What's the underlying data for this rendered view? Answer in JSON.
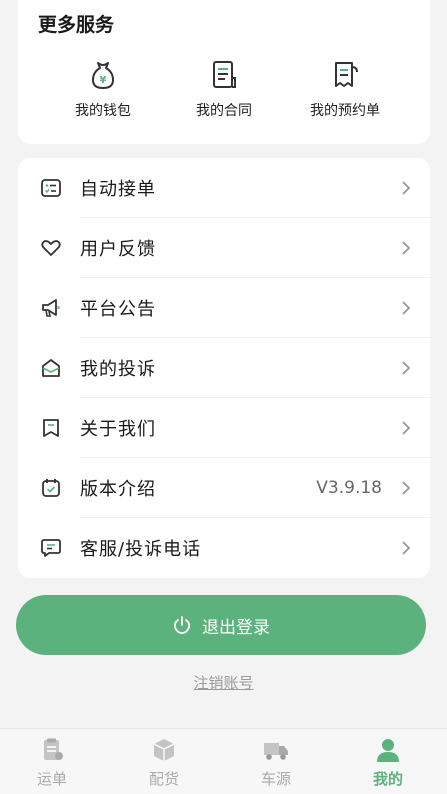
{
  "services": {
    "title": "更多服务",
    "items": [
      {
        "label": "我的钱包",
        "icon": "wallet-icon"
      },
      {
        "label": "我的合同",
        "icon": "contract-icon"
      },
      {
        "label": "我的预约单",
        "icon": "receipt-icon"
      }
    ]
  },
  "menu": {
    "items": [
      {
        "label": "自动接单",
        "icon": "task-list-icon"
      },
      {
        "label": "用户反馈",
        "icon": "heart-icon"
      },
      {
        "label": "平台公告",
        "icon": "megaphone-icon"
      },
      {
        "label": "我的投诉",
        "icon": "mail-icon"
      },
      {
        "label": "关于我们",
        "icon": "bookmark-icon"
      },
      {
        "label": "版本介绍",
        "icon": "calendar-check-icon",
        "value": "V3.9.18"
      },
      {
        "label": "客服/投诉电话",
        "icon": "chat-icon"
      }
    ]
  },
  "logout": {
    "label": "退出登录"
  },
  "cancel_account": {
    "label": "注销账号"
  },
  "tabbar": {
    "items": [
      {
        "label": "运单",
        "icon": "waybill-icon"
      },
      {
        "label": "配货",
        "icon": "box-icon"
      },
      {
        "label": "车源",
        "icon": "truck-icon"
      },
      {
        "label": "我的",
        "icon": "user-icon",
        "active": true
      }
    ]
  },
  "colors": {
    "accent": "#5bb27c",
    "background": "#f3f3f3"
  }
}
